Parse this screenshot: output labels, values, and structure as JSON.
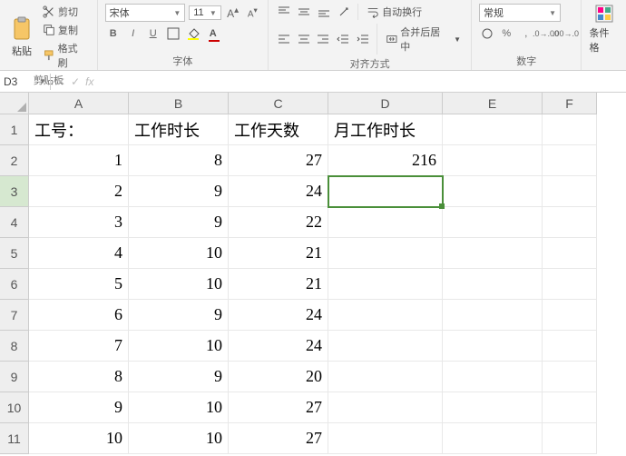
{
  "ribbon": {
    "clipboard": {
      "paste": "粘贴",
      "cut": "剪切",
      "copy": "复制",
      "format_painter": "格式刷",
      "group_label": "剪贴板"
    },
    "font": {
      "name": "宋体",
      "size": "11",
      "bold": "B",
      "italic": "I",
      "underline": "U",
      "group_label": "字体"
    },
    "alignment": {
      "wrap_text": "自动换行",
      "merge_center": "合并后居中",
      "group_label": "对齐方式"
    },
    "number": {
      "format": "常规",
      "percent": "%",
      "comma": ",",
      "inc_dec_0": ".0",
      "group_label": "数字"
    },
    "styles": {
      "cond_format": "条件格"
    }
  },
  "fx_bar": {
    "name_box": "D3",
    "cancel": "✕",
    "confirm": "✓",
    "fx": "fx",
    "formula": ""
  },
  "columns": [
    "A",
    "B",
    "C",
    "D",
    "E",
    "F"
  ],
  "row_numbers": [
    "1",
    "2",
    "3",
    "4",
    "5",
    "6",
    "7",
    "8",
    "9",
    "10",
    "11"
  ],
  "headers": {
    "A": "工号：",
    "B": "工作时长",
    "C": "工作天数",
    "D": "月工作时长"
  },
  "data": [
    {
      "A": "1",
      "B": "8",
      "C": "27",
      "D": "216"
    },
    {
      "A": "2",
      "B": "9",
      "C": "24",
      "D": ""
    },
    {
      "A": "3",
      "B": "9",
      "C": "22",
      "D": ""
    },
    {
      "A": "4",
      "B": "10",
      "C": "21",
      "D": ""
    },
    {
      "A": "5",
      "B": "10",
      "C": "21",
      "D": ""
    },
    {
      "A": "6",
      "B": "9",
      "C": "24",
      "D": ""
    },
    {
      "A": "7",
      "B": "10",
      "C": "24",
      "D": ""
    },
    {
      "A": "8",
      "B": "9",
      "C": "20",
      "D": ""
    },
    {
      "A": "9",
      "B": "10",
      "C": "27",
      "D": ""
    },
    {
      "A": "10",
      "B": "10",
      "C": "27",
      "D": ""
    }
  ],
  "selected_cell": "D3"
}
